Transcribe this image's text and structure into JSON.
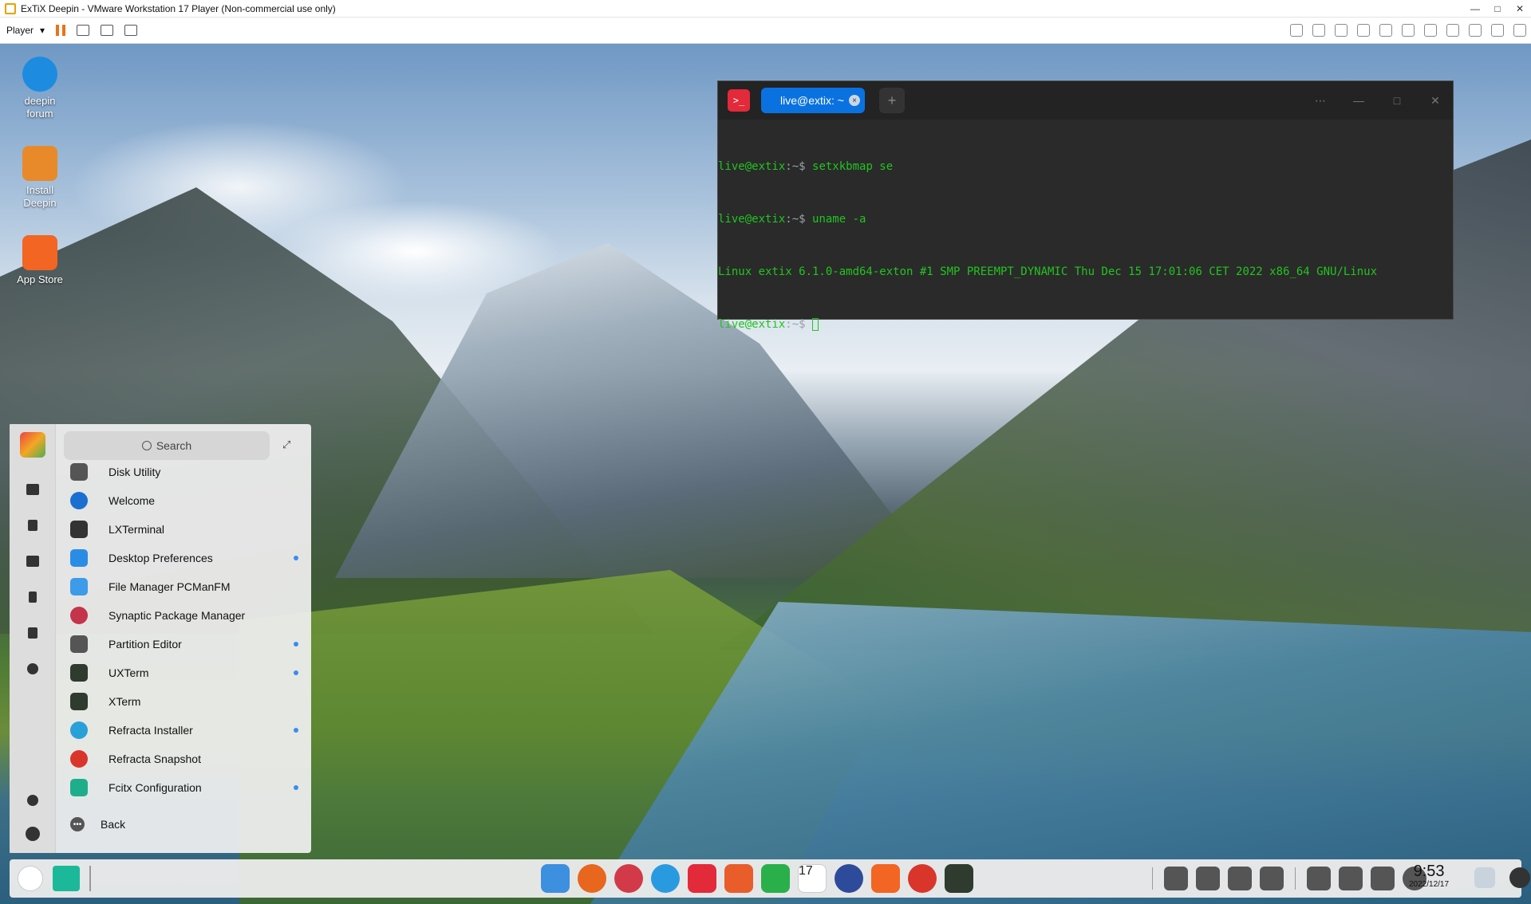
{
  "vm": {
    "title": "ExTiX Deepin - VMware Workstation 17 Player (Non-commercial use only)",
    "player_label": "Player",
    "player_caret": "▾",
    "window_buttons": [
      "—",
      "□",
      "✕"
    ]
  },
  "desktop_icons": [
    {
      "label": "deepin\nforum",
      "icon": "deepin-forum-icon",
      "color": "#1d8ce0"
    },
    {
      "label": "Install\nDeepin",
      "icon": "install-deepin-icon",
      "color": "#e88a2a"
    },
    {
      "label": "App Store",
      "icon": "app-store-icon",
      "color": "#f26522"
    }
  ],
  "terminal": {
    "tab_label": "live@extix: ~",
    "tab_close": "×",
    "add_tab": "+",
    "controls": [
      "⋯",
      "—",
      "□",
      "✕"
    ],
    "lines": [
      {
        "user": "live@extix",
        "sep": ":~$ ",
        "text": "setxkbmap se"
      },
      {
        "user": "live@extix",
        "sep": ":~$ ",
        "text": "uname -a"
      },
      {
        "user": "",
        "sep": "",
        "text": "Linux extix 6.1.0-amd64-exton #1 SMP PREEMPT_DYNAMIC Thu Dec 15 17:01:06 CET 2022 x86_64 GNU/Linux"
      },
      {
        "user": "live@extix",
        "sep": ":~$ ",
        "text": ""
      }
    ],
    "colors": {
      "text": "#21c41f",
      "bg": "#2a2a2a"
    }
  },
  "launcher": {
    "search_placeholder": "Search",
    "expand_icon": "⤢",
    "back_label": "Back",
    "apps": [
      {
        "label": "Disk Utility",
        "icon": "disk-utility-icon",
        "color": "#555555",
        "new": false
      },
      {
        "label": "Welcome",
        "icon": "welcome-icon",
        "color": "#1a6fd0",
        "new": false
      },
      {
        "label": "LXTerminal",
        "icon": "lxterminal-icon",
        "color": "#333333",
        "new": false
      },
      {
        "label": "Desktop Preferences",
        "icon": "desktop-preferences-icon",
        "color": "#2b8ce6",
        "new": true
      },
      {
        "label": "File Manager PCManFM",
        "icon": "file-manager-icon",
        "color": "#3d9be9",
        "new": false
      },
      {
        "label": "Synaptic Package Manager",
        "icon": "synaptic-icon",
        "color": "#c4344a",
        "new": false
      },
      {
        "label": "Partition Editor",
        "icon": "partition-editor-icon",
        "color": "#555555",
        "new": true
      },
      {
        "label": "UXTerm",
        "icon": "uxterm-icon",
        "color": "#2e3b2e",
        "new": true
      },
      {
        "label": "XTerm",
        "icon": "xterm-icon",
        "color": "#2e3b2e",
        "new": false
      },
      {
        "label": "Refracta Installer",
        "icon": "refracta-installer-icon",
        "color": "#2aa0d8",
        "new": true
      },
      {
        "label": "Refracta Snapshot",
        "icon": "refracta-snapshot-icon",
        "color": "#d9352b",
        "new": false
      },
      {
        "label": "Fcitx Configuration",
        "icon": "fcitx-icon",
        "color": "#1fae8c",
        "new": true
      }
    ],
    "side_icons": [
      "computer-icon",
      "document-icon",
      "image-icon",
      "music-icon",
      "video-icon",
      "download-icon",
      "settings-icon",
      "power-icon"
    ]
  },
  "dock": {
    "apps": [
      {
        "icon": "file-manager-icon",
        "color": "#3d8fe0"
      },
      {
        "icon": "firefox-icon",
        "color": "#e8661e"
      },
      {
        "icon": "download-manager-icon",
        "color": "#d23a4a"
      },
      {
        "icon": "control-center-icon",
        "color": "#2a9ae0"
      },
      {
        "icon": "terminal-icon",
        "color": "#e32a3a"
      },
      {
        "icon": "image-viewer-icon",
        "color": "#e85d2a"
      },
      {
        "icon": "music-icon",
        "color": "#2ab04a"
      },
      {
        "icon": "calendar-icon",
        "color": "#ffffff"
      },
      {
        "icon": "system-monitor-icon",
        "color": "#2e4a9a"
      },
      {
        "icon": "app-store-icon",
        "color": "#f26522"
      },
      {
        "icon": "refracta-snapshot-icon",
        "color": "#d9352b"
      },
      {
        "icon": "xterm-icon",
        "color": "#2e3b2e"
      }
    ],
    "calendar_day": "17",
    "tray_icons": [
      "keyboard-icon",
      "volume-icon",
      "pen-icon",
      "expand-tray-icon",
      "screenshot-icon",
      "search-icon",
      "window-icon",
      "power-icon"
    ],
    "clock_time": "9:53",
    "clock_date": "2022/12/17",
    "end_icons": [
      "trash-icon",
      "notification-icon"
    ]
  }
}
